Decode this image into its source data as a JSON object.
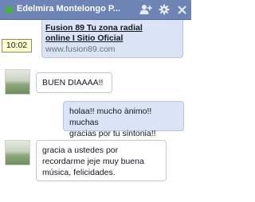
{
  "chat": {
    "contact_name": "Edelmira Montelongo P...",
    "status_color": "#42b72a",
    "icons": [
      "add-person-icon",
      "gear-icon",
      "close-icon"
    ]
  },
  "link_preview": {
    "title_line1": "Fusion 89 Tu zona radial",
    "title_line2": "online I Sitio Oficial",
    "url": "www.fusion89.com"
  },
  "timestamp": "10:02",
  "messages": [
    {
      "direction": "in",
      "text": "BUEN DIAAAA!!"
    },
    {
      "direction": "out",
      "line1": "holaa!! mucho ànimo!! muchas",
      "line2": "gracias por tu sintonia!!"
    },
    {
      "direction": "in",
      "line1": "gracia  a ustedes por",
      "line2": "recordarme jeje muy buena",
      "line3": "música, felicidades."
    }
  ]
}
